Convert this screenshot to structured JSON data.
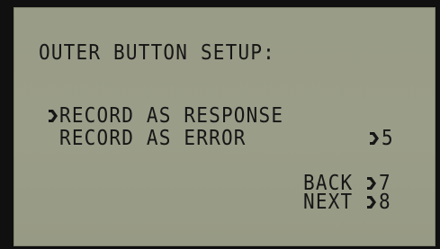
{
  "screen": {
    "title": "OUTER BUTTON SETUP:",
    "options": [
      {
        "label": "RECORD AS RESPONSE",
        "selected": true,
        "key": ""
      },
      {
        "label": "RECORD AS ERROR",
        "selected": false,
        "key": "5"
      }
    ],
    "nav": [
      {
        "label": "BACK",
        "key": "7"
      },
      {
        "label": "NEXT",
        "key": "8"
      }
    ]
  },
  "colors": {
    "lcd_background": "#9a9d88",
    "lcd_text": "#161616",
    "bezel": "#101010"
  },
  "icons": {
    "selection_cursor": "arrow-right-icon",
    "key_indicator": "arrow-right-icon"
  }
}
